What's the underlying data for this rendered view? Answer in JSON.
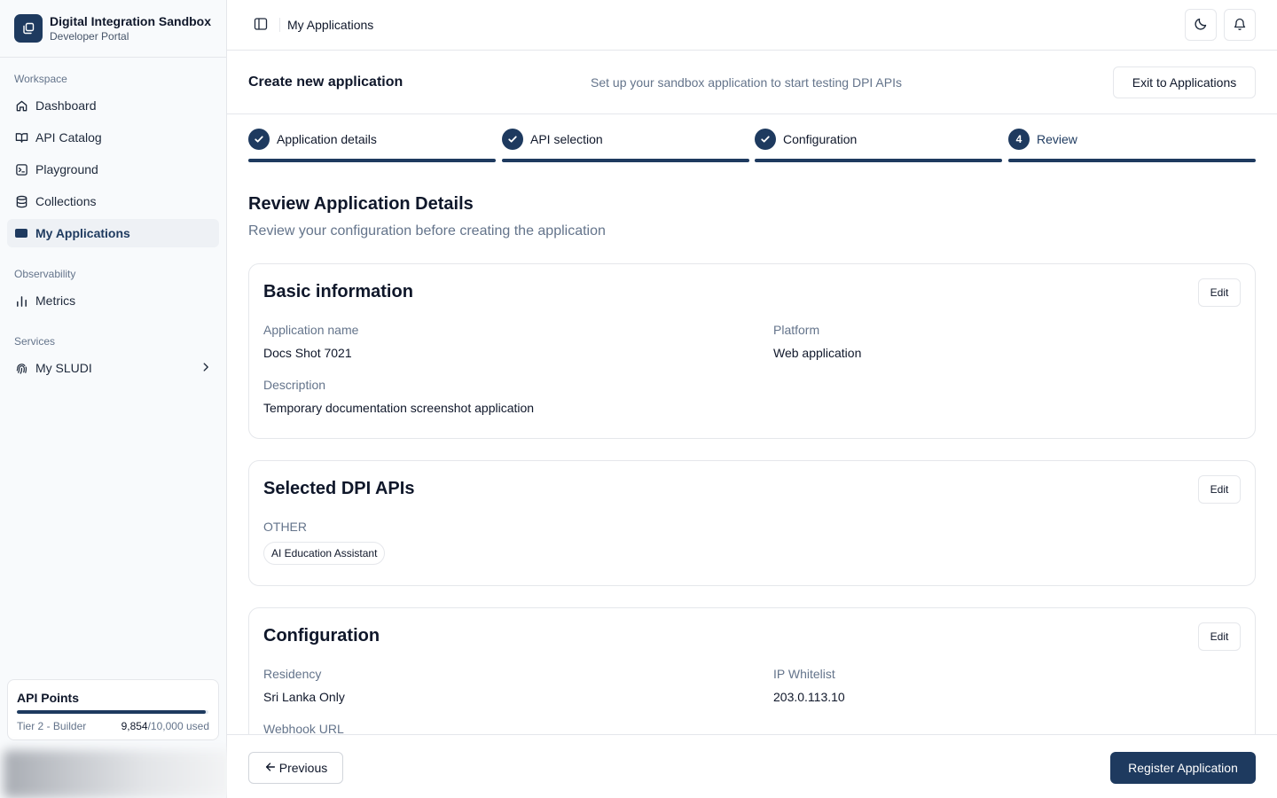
{
  "brand": {
    "title": "Digital Integration Sandbox",
    "subtitle": "Developer Portal",
    "logo_icon": "copy-icon"
  },
  "sidebar": {
    "sections": [
      {
        "label": "Workspace",
        "items": [
          {
            "label": "Dashboard",
            "icon": "home-icon"
          },
          {
            "label": "API Catalog",
            "icon": "book-icon"
          },
          {
            "label": "Playground",
            "icon": "terminal-icon"
          },
          {
            "label": "Collections",
            "icon": "database-icon"
          },
          {
            "label": "My Applications",
            "icon": "app-icon",
            "active": true
          }
        ]
      },
      {
        "label": "Observability",
        "items": [
          {
            "label": "Metrics",
            "icon": "bar-chart-icon"
          }
        ]
      },
      {
        "label": "Services",
        "items": [
          {
            "label": "My SLUDI",
            "icon": "fingerprint-icon",
            "has_submenu": true
          }
        ]
      }
    ],
    "api_points": {
      "title": "API Points",
      "tier": "Tier 2 - Builder",
      "used": "9,854",
      "total_suffix": "/10,000 used",
      "fraction": 0.9854
    }
  },
  "topbar": {
    "title": "My Applications",
    "theme_icon": "moon-icon",
    "notify_icon": "bell-icon"
  },
  "page_header": {
    "title": "Create new application",
    "subtitle": "Set up your sandbox application to start testing DPI APIs",
    "exit_label": "Exit to Applications"
  },
  "steps": [
    {
      "label": "Application details",
      "state": "complete"
    },
    {
      "label": "API selection",
      "state": "complete"
    },
    {
      "label": "Configuration",
      "state": "complete"
    },
    {
      "label": "Review",
      "state": "current",
      "number": "4"
    }
  ],
  "review": {
    "title": "Review Application Details",
    "subtitle": "Review your configuration before creating the application",
    "edit_label": "Edit",
    "basic": {
      "title": "Basic information",
      "name_label": "Application name",
      "name_value": "Docs Shot 7021",
      "platform_label": "Platform",
      "platform_value": "Web application",
      "description_label": "Description",
      "description_value": "Temporary documentation screenshot application"
    },
    "apis": {
      "title": "Selected DPI APIs",
      "group_label": "OTHER",
      "items": [
        "AI Education Assistant"
      ]
    },
    "configuration": {
      "title": "Configuration",
      "residency_label": "Residency",
      "residency_value": "Sri Lanka Only",
      "ip_label": "IP Whitelist",
      "ip_value": "203.0.113.10",
      "webhook_label": "Webhook URL"
    }
  },
  "footer": {
    "previous_label": "Previous",
    "register_label": "Register Application"
  },
  "colors": {
    "primary": "#1e3a5f",
    "muted_text": "#64748b",
    "border": "#e5e7eb",
    "sidebar_bg": "#f8fafc"
  }
}
